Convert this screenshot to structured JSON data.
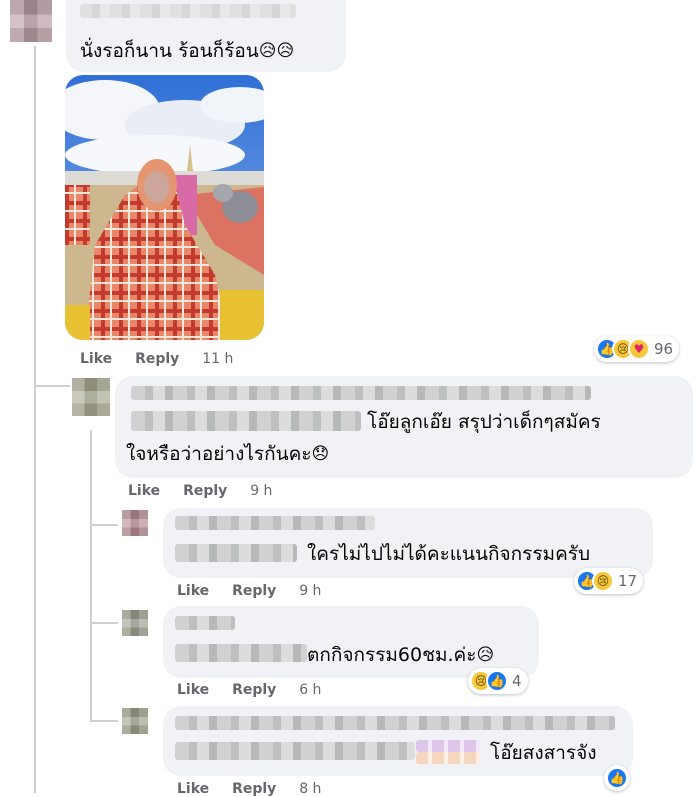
{
  "comments": [
    {
      "text": "นั่งรอก็นาน ร้อนก็ร้อน",
      "emoji": "😥😥",
      "has_photo": true,
      "actions": {
        "like": "Like",
        "reply": "Reply",
        "time": "11 h"
      },
      "reactions": {
        "icons": [
          "like-icon",
          "sad-icon",
          "care-icon"
        ],
        "count": "96"
      }
    },
    {
      "text_line1": "โอ๊ยลูกเอ๊ย สรุปว่าเด็กๆสมัคร",
      "text_line2": "ใจหรือว่าอย่างไรกันคะ",
      "emoji": "😞",
      "actions": {
        "like": "Like",
        "reply": "Reply",
        "time": "9 h"
      }
    },
    {
      "text": "ใครไม่ไปไม่ได้คะแนนกิจกรรมครับ",
      "actions": {
        "like": "Like",
        "reply": "Reply",
        "time": "9 h"
      },
      "reactions": {
        "icons": [
          "like-icon",
          "sad-icon"
        ],
        "count": "17"
      }
    },
    {
      "text": "ตกกิจกรรม60ชม.ค่ะ",
      "emoji": "😥",
      "actions": {
        "like": "Like",
        "reply": "Reply",
        "time": "6 h"
      },
      "reactions": {
        "icons": [
          "sad-icon",
          "like-icon"
        ],
        "count": "4"
      }
    },
    {
      "text": "โอ๊ยสงสารจัง",
      "actions": {
        "like": "Like",
        "reply": "Reply",
        "time": "8 h"
      },
      "reactions": {
        "icons": [
          "like-icon"
        ]
      }
    }
  ],
  "colors": {
    "like_blue": "#1877f2",
    "bubble_bg": "#f0f2f5",
    "meta_gray": "#65676b"
  }
}
